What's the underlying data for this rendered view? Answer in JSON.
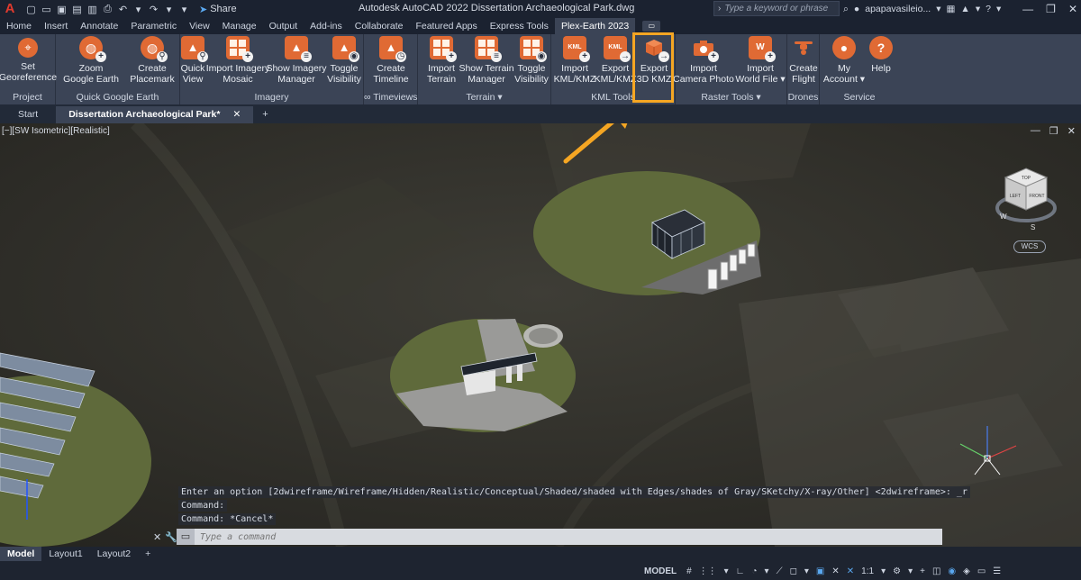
{
  "app": {
    "logo": "A",
    "title": "Autodesk AutoCAD 2022   Dissertation Archaeological Park.dwg",
    "share_label": "Share",
    "search_placeholder": "Type a keyword or phrase",
    "user": "apapavasileio...",
    "help": "?"
  },
  "ribbon_tabs": [
    "Home",
    "Insert",
    "Annotate",
    "Parametric",
    "View",
    "Manage",
    "Output",
    "Add-ins",
    "Collaborate",
    "Featured Apps",
    "Express Tools",
    "Plex-Earth 2023"
  ],
  "active_ribbon_tab": "Plex-Earth 2023",
  "panels": {
    "project": {
      "title": "Project",
      "buttons": [
        {
          "label1": "Set",
          "label2": "Georeference",
          "icon": "georeference-icon"
        }
      ]
    },
    "quick_google_earth": {
      "title": "Quick Google Earth",
      "buttons": [
        {
          "label1": "Zoom",
          "label2": "Google Earth",
          "icon": "google-earth-zoom-icon"
        },
        {
          "label1": "Create",
          "label2": "Placemark",
          "icon": "placemark-icon"
        }
      ]
    },
    "imagery": {
      "title": "Imagery",
      "buttons": [
        {
          "label1": "Quick",
          "label2": "View",
          "icon": "quick-view-icon"
        },
        {
          "label1": "Import Imagery",
          "label2": "Mosaic",
          "icon": "imagery-mosaic-icon"
        },
        {
          "label1": "Show Imagery",
          "label2": "Manager",
          "icon": "imagery-manager-icon"
        },
        {
          "label1": "Toggle",
          "label2": "Visibility",
          "icon": "visibility-icon"
        }
      ]
    },
    "timeviews": {
      "title": "∞ Timeviews",
      "buttons": [
        {
          "label1": "Create",
          "label2": "Timeline",
          "icon": "timeline-icon"
        }
      ]
    },
    "terrain": {
      "title": "Terrain",
      "buttons": [
        {
          "label1": "Import",
          "label2": "Terrain",
          "icon": "terrain-import-icon"
        },
        {
          "label1": "Show Terrain",
          "label2": "Manager",
          "icon": "terrain-manager-icon"
        },
        {
          "label1": "Toggle",
          "label2": "Visibility",
          "icon": "visibility-icon"
        }
      ]
    },
    "kml_tools": {
      "title": "KML Tools",
      "buttons": [
        {
          "label1": "Import",
          "label2": "KML/KMZ",
          "icon": "kml-import-icon"
        },
        {
          "label1": "Export",
          "label2": "KML/KMZ",
          "icon": "kml-export-icon"
        },
        {
          "label1": "Export",
          "label2": "3D KMZ",
          "icon": "3d-kmz-export-icon"
        }
      ]
    },
    "raster_tools": {
      "title": "Raster Tools",
      "buttons": [
        {
          "label1": "Import",
          "label2": "Camera Photo",
          "icon": "camera-photo-icon"
        },
        {
          "label1": "Import",
          "label2": "World File",
          "icon": "world-file-icon"
        }
      ]
    },
    "drones": {
      "title": "Drones",
      "buttons": [
        {
          "label1": "Create",
          "label2": "Flight",
          "icon": "drone-icon"
        }
      ]
    },
    "service": {
      "title": "Service",
      "buttons": [
        {
          "label1": "My",
          "label2": "Account",
          "icon": "account-icon"
        },
        {
          "label1": "Help",
          "label2": "",
          "icon": "help-icon"
        }
      ]
    }
  },
  "doc_tabs": {
    "start": "Start",
    "active": "Dissertation Archaeological Park*",
    "close": "✕",
    "add": "+"
  },
  "viewport": {
    "label": "[−][SW Isometric][Realistic]",
    "wcs": "WCS",
    "viewcube_faces": {
      "top": "TOP",
      "front": "FRONT",
      "left": "LEFT"
    },
    "compass": {
      "s": "S",
      "w": "W"
    }
  },
  "command": {
    "history": [
      "Enter an option [2dwireframe/Wireframe/Hidden/Realistic/Conceptual/Shaded/shaded with Edges/shades of Gray/SKetchy/X-ray/Other] <2dwireframe>: _r",
      "Command:",
      "Command: *Cancel*"
    ],
    "placeholder": "Type a command"
  },
  "layout_tabs": [
    "Model",
    "Layout1",
    "Layout2"
  ],
  "layout_add": "+",
  "status": {
    "model": "MODEL",
    "scale": "1:1"
  },
  "colors": {
    "accent_highlight": "#f5a623",
    "plex_orange": "#e06a34",
    "ribbon_bg": "#3b4456",
    "titlebar_bg": "#1b2230"
  }
}
